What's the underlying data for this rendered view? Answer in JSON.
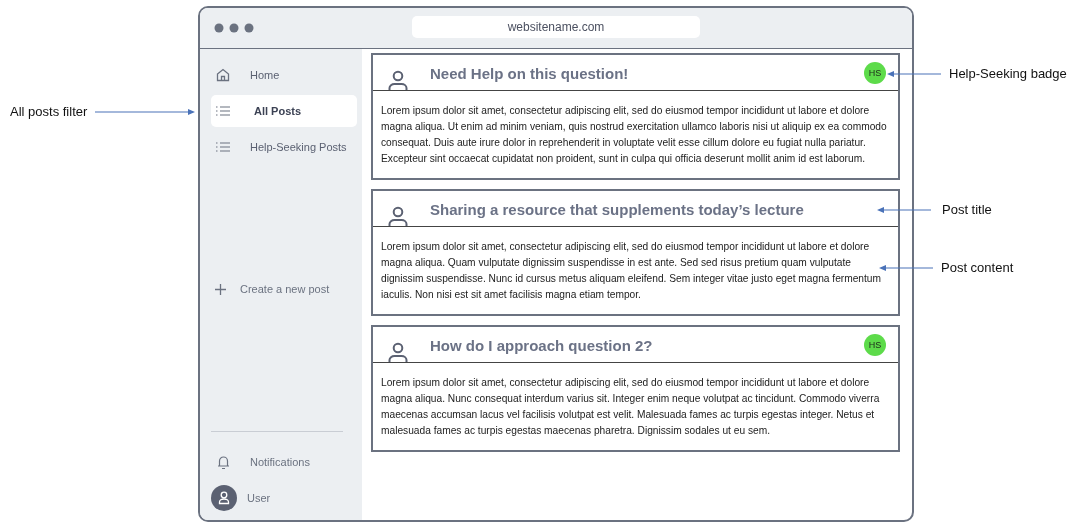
{
  "browser": {
    "url": "websitename.com"
  },
  "sidebar": {
    "items": [
      {
        "label": "Home",
        "kind": "home",
        "selected": false
      },
      {
        "label": "All Posts",
        "kind": "list",
        "selected": true
      },
      {
        "label": "Help-Seeking Posts",
        "kind": "list",
        "selected": false
      }
    ],
    "create_button": "Create a new post",
    "notifications": "Notifications",
    "user": "User"
  },
  "posts": [
    {
      "title": "Need Help on this question!",
      "badge": "HS",
      "content": "Lorem ipsum dolor sit amet, consectetur adipiscing elit, sed do eiusmod tempor incididunt ut labore et dolore magna aliqua. Ut enim ad minim veniam, quis nostrud exercitation ullamco laboris nisi ut aliquip ex ea commodo consequat. Duis aute irure dolor in reprehenderit in voluptate velit esse cillum dolore eu fugiat nulla pariatur. Excepteur sint occaecat cupidatat non proident, sunt in culpa qui officia deserunt mollit anim id est laborum."
    },
    {
      "title": "Sharing a resource that supplements today’s lecture",
      "content": "Lorem ipsum dolor sit amet, consectetur adipiscing elit, sed do eiusmod tempor incididunt ut labore et dolore magna aliqua. Quam vulputate dignissim suspendisse in est ante. Sed sed risus pretium quam vulputate dignissim suspendisse. Nunc id cursus metus aliquam eleifend. Sem integer vitae justo eget magna fermentum iaculis. Non nisi est sit amet facilisis magna etiam tempor."
    },
    {
      "title": "How do I approach question 2?",
      "badge": "HS",
      "content": "Lorem ipsum dolor sit amet, consectetur adipiscing elit, sed do eiusmod tempor incididunt ut labore et dolore magna aliqua. Nunc consequat interdum varius sit. Integer enim neque volutpat ac tincidunt. Commodo viverra maecenas accumsan lacus vel facilisis volutpat est velit. Malesuada fames ac turpis egestas integer. Netus et malesuada fames ac turpis egestas maecenas pharetra. Dignissim sodales ut eu sem."
    }
  ],
  "annotations": [
    {
      "text": "All posts filter",
      "kind": "left"
    },
    {
      "text": "Help-Seeking badge",
      "kind": "right"
    },
    {
      "text": "Post title",
      "kind": "right"
    },
    {
      "text": "Post content",
      "kind": "right"
    }
  ]
}
